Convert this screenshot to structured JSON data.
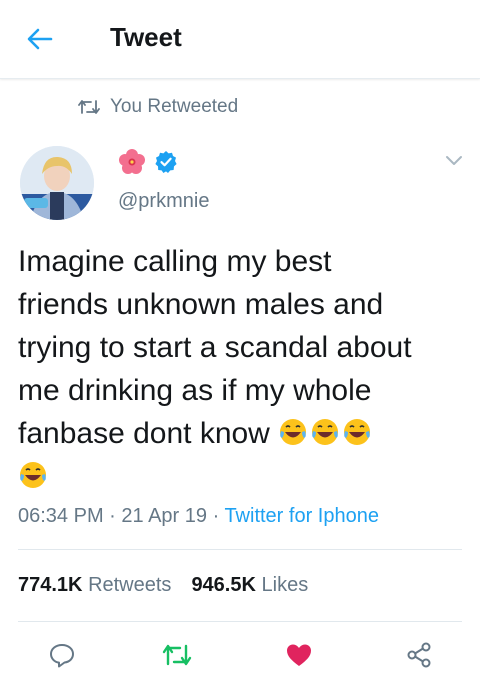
{
  "header": {
    "title": "Tweet"
  },
  "context": {
    "label": "You Retweeted"
  },
  "author": {
    "handle": "@prkmnie"
  },
  "tweet": {
    "lines": [
      "Imagine calling my best",
      "friends unknown males and",
      "trying to start a scandal about",
      "me drinking as if my whole",
      "fanbase dont know"
    ],
    "time": "06:34 PM",
    "date": "21 Apr 19",
    "source": "Twitter for Iphone"
  },
  "stats": {
    "retweets_count": "774.1K",
    "retweets_label": "Retweets",
    "likes_count": "946.5K",
    "likes_label": "Likes"
  },
  "colors": {
    "accent": "#1da1f2",
    "retweet": "#17bf63",
    "like": "#e0245e",
    "muted": "#657786"
  },
  "icons": [
    "back-arrow-icon",
    "retweet-icon",
    "flower-icon",
    "verified-badge-icon",
    "chevron-down-icon",
    "laughing-emoji-icon",
    "reply-icon",
    "heart-icon",
    "share-icon"
  ]
}
